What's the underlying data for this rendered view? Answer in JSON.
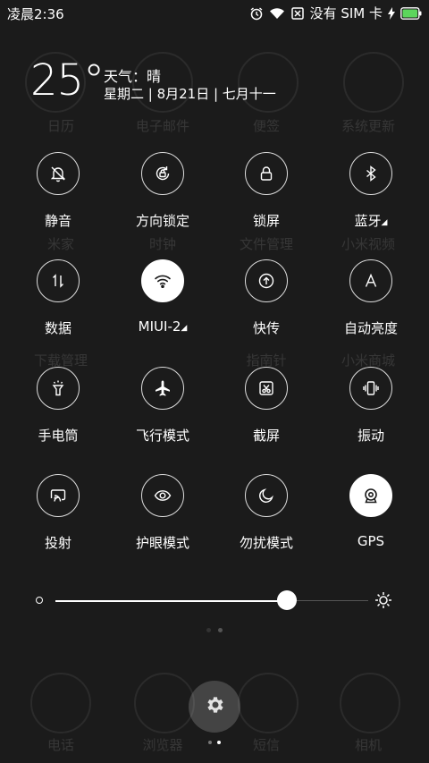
{
  "status_bar": {
    "time": "凌晨2:36",
    "carrier": "没有 SIM 卡",
    "icons": [
      "alarm-icon",
      "wifi-icon",
      "no-sim-icon",
      "charging-icon",
      "battery-icon"
    ],
    "battery_color": "#5cd65c"
  },
  "weather": {
    "temperature": "25°",
    "condition": "天气：晴",
    "date_line": "星期二 | 8月21日 | 七月十一"
  },
  "home_labels": [
    "日历",
    "电子邮件",
    "便签",
    "系统更新",
    "米家",
    "时钟",
    "文件管理",
    "小米视频",
    "下载管理",
    "指南针",
    "小米商城",
    "电话",
    "浏览器",
    "短信",
    "相机"
  ],
  "toggles": [
    {
      "label": "静音",
      "icon": "silent-icon",
      "on": false
    },
    {
      "label": "方向锁定",
      "icon": "rotation-lock-icon",
      "on": false
    },
    {
      "label": "锁屏",
      "icon": "lock-icon",
      "on": false
    },
    {
      "label": "蓝牙",
      "icon": "bluetooth-icon",
      "on": false
    },
    {
      "label": "数据",
      "icon": "data-icon",
      "on": false
    },
    {
      "label": "MIUI-2",
      "icon": "wifi-icon",
      "on": true
    },
    {
      "label": "快传",
      "icon": "quick-transfer-icon",
      "on": false
    },
    {
      "label": "自动亮度",
      "icon": "auto-brightness-icon",
      "on": false
    },
    {
      "label": "手电筒",
      "icon": "flashlight-icon",
      "on": false
    },
    {
      "label": "飞行模式",
      "icon": "airplane-icon",
      "on": false
    },
    {
      "label": "截屏",
      "icon": "screenshot-icon",
      "on": false
    },
    {
      "label": "振动",
      "icon": "vibrate-icon",
      "on": false
    },
    {
      "label": "投射",
      "icon": "cast-icon",
      "on": false
    },
    {
      "label": "护眼模式",
      "icon": "eye-icon",
      "on": false
    },
    {
      "label": "勿扰模式",
      "icon": "moon-icon",
      "on": false
    },
    {
      "label": "GPS",
      "icon": "gps-icon",
      "on": true
    }
  ],
  "brightness": {
    "level": 0.74
  },
  "colors": {
    "background": "#1b1b1b",
    "toggle_on": "#ffffff"
  }
}
